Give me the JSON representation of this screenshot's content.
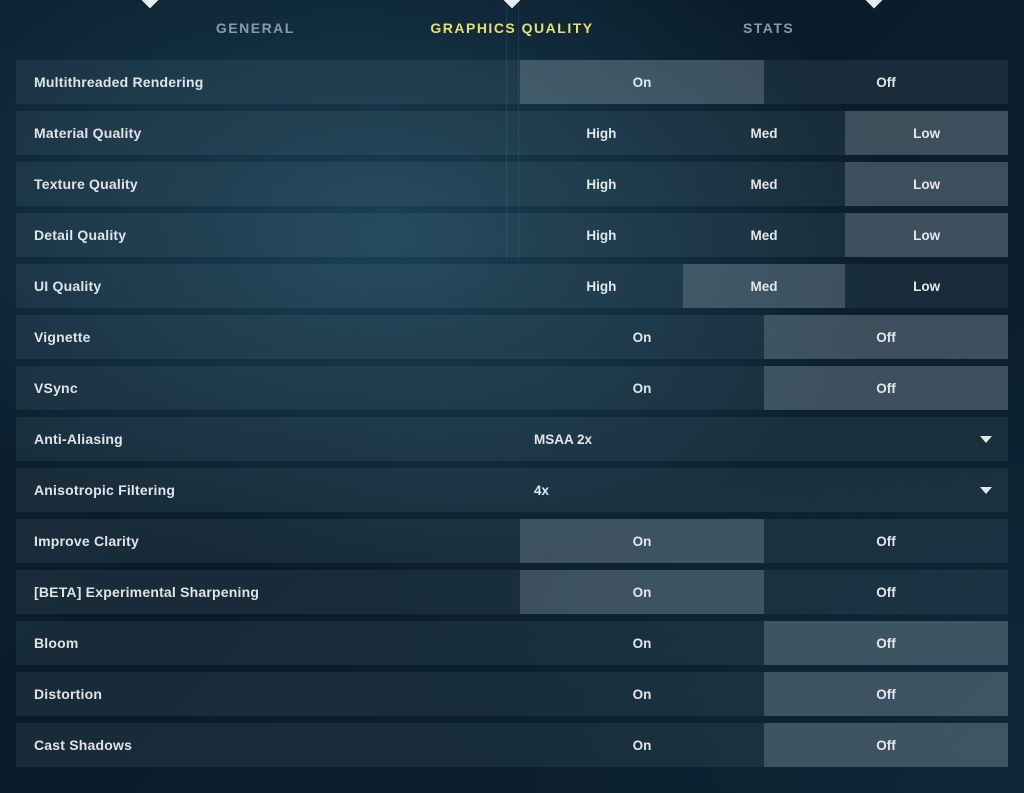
{
  "tabs": {
    "general": "GENERAL",
    "graphics": "GRAPHICS QUALITY",
    "stats": "STATS",
    "active": "graphics"
  },
  "options": {
    "on": "On",
    "off": "Off",
    "high": "High",
    "med": "Med",
    "low": "Low"
  },
  "settings": [
    {
      "key": "multithreaded",
      "label": "Multithreaded Rendering",
      "type": "onoff",
      "value": "on"
    },
    {
      "key": "material",
      "label": "Material Quality",
      "type": "hml",
      "value": "low"
    },
    {
      "key": "texture",
      "label": "Texture Quality",
      "type": "hml",
      "value": "low"
    },
    {
      "key": "detail",
      "label": "Detail Quality",
      "type": "hml",
      "value": "low"
    },
    {
      "key": "ui",
      "label": "UI Quality",
      "type": "hml",
      "value": "med"
    },
    {
      "key": "vignette",
      "label": "Vignette",
      "type": "onoff",
      "value": "off"
    },
    {
      "key": "vsync",
      "label": "VSync",
      "type": "onoff",
      "value": "off"
    },
    {
      "key": "aa",
      "label": "Anti-Aliasing",
      "type": "dropdown",
      "value": "MSAA 2x"
    },
    {
      "key": "aniso",
      "label": "Anisotropic Filtering",
      "type": "dropdown",
      "value": "4x"
    },
    {
      "key": "clarity",
      "label": "Improve Clarity",
      "type": "onoff",
      "value": "on"
    },
    {
      "key": "sharpen",
      "label": "[BETA] Experimental Sharpening",
      "type": "onoff",
      "value": "on"
    },
    {
      "key": "bloom",
      "label": "Bloom",
      "type": "onoff",
      "value": "off"
    },
    {
      "key": "distortion",
      "label": "Distortion",
      "type": "onoff",
      "value": "off"
    },
    {
      "key": "shadows",
      "label": "Cast Shadows",
      "type": "onoff",
      "value": "off"
    }
  ]
}
